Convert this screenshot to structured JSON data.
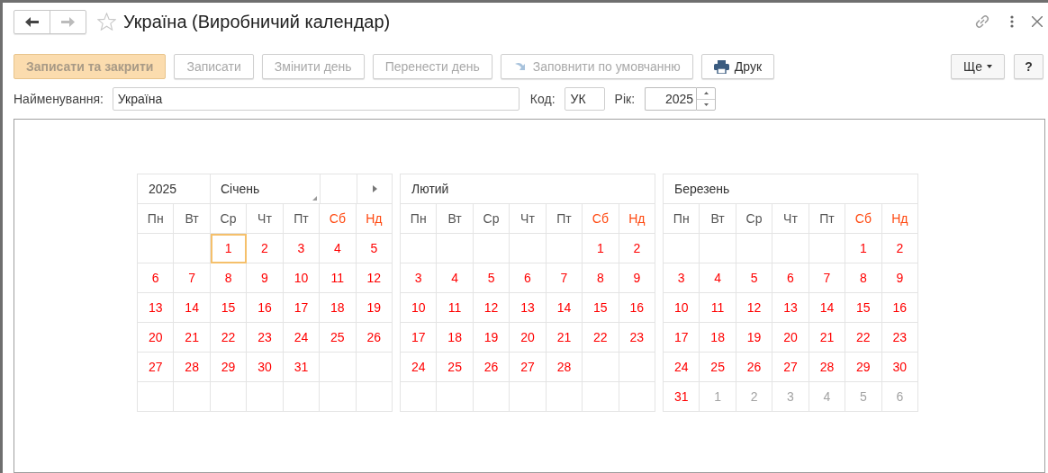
{
  "window": {
    "title": "Україна (Виробничий календар)",
    "favorite": false
  },
  "toolbar": {
    "buttons": [
      {
        "label": "Записати та закрити",
        "kind": "default",
        "disabled": true
      },
      {
        "label": "Записати",
        "kind": "plain",
        "disabled": true
      },
      {
        "label": "Змінити день",
        "kind": "plain",
        "disabled": true
      },
      {
        "label": "Перенести день",
        "kind": "plain",
        "disabled": true
      },
      {
        "label": "Заповнити по умовчанню",
        "kind": "fill",
        "disabled": true
      },
      {
        "label": "Друк",
        "kind": "print",
        "disabled": false
      }
    ],
    "more": {
      "label": "Ще"
    },
    "help": {
      "label": "?"
    }
  },
  "fields": {
    "name": {
      "label": "Найменування:",
      "value": "Україна"
    },
    "code": {
      "label": "Код:",
      "value": "УК"
    },
    "year": {
      "label": "Рік:",
      "value": "2025"
    }
  },
  "calendar": {
    "year": "2025",
    "months": [
      {
        "name": "Січень",
        "weekdays": [
          {
            "label": "Пн",
            "weekend": false
          },
          {
            "label": "Вт",
            "weekend": false
          },
          {
            "label": "Ср",
            "weekend": false
          },
          {
            "label": "Чт",
            "weekend": false
          },
          {
            "label": "Пт",
            "weekend": false
          },
          {
            "label": "Сб",
            "weekend": true
          },
          {
            "label": "Нд",
            "weekend": true
          }
        ],
        "weeks": [
          [
            {
              "kind": "blank",
              "selected": false
            },
            {
              "kind": "blank",
              "selected": false
            },
            {
              "kind": "day",
              "d": "1",
              "selected": true
            },
            {
              "kind": "day",
              "d": "2",
              "selected": false
            },
            {
              "kind": "day",
              "d": "3",
              "selected": false
            },
            {
              "kind": "day",
              "d": "4",
              "selected": false
            },
            {
              "kind": "day",
              "d": "5",
              "selected": false
            }
          ],
          [
            {
              "kind": "day",
              "d": "6",
              "selected": false
            },
            {
              "kind": "day",
              "d": "7",
              "selected": false
            },
            {
              "kind": "day",
              "d": "8",
              "selected": false
            },
            {
              "kind": "day",
              "d": "9",
              "selected": false
            },
            {
              "kind": "day",
              "d": "10",
              "selected": false
            },
            {
              "kind": "day",
              "d": "11",
              "selected": false
            },
            {
              "kind": "day",
              "d": "12",
              "selected": false
            }
          ],
          [
            {
              "kind": "day",
              "d": "13",
              "selected": false
            },
            {
              "kind": "day",
              "d": "14",
              "selected": false
            },
            {
              "kind": "day",
              "d": "15",
              "selected": false
            },
            {
              "kind": "day",
              "d": "16",
              "selected": false
            },
            {
              "kind": "day",
              "d": "17",
              "selected": false
            },
            {
              "kind": "day",
              "d": "18",
              "selected": false
            },
            {
              "kind": "day",
              "d": "19",
              "selected": false
            }
          ],
          [
            {
              "kind": "day",
              "d": "20",
              "selected": false
            },
            {
              "kind": "day",
              "d": "21",
              "selected": false
            },
            {
              "kind": "day",
              "d": "22",
              "selected": false
            },
            {
              "kind": "day",
              "d": "23",
              "selected": false
            },
            {
              "kind": "day",
              "d": "24",
              "selected": false
            },
            {
              "kind": "day",
              "d": "25",
              "selected": false
            },
            {
              "kind": "day",
              "d": "26",
              "selected": false
            }
          ],
          [
            {
              "kind": "day",
              "d": "27",
              "selected": false
            },
            {
              "kind": "day",
              "d": "28",
              "selected": false
            },
            {
              "kind": "day",
              "d": "29",
              "selected": false
            },
            {
              "kind": "day",
              "d": "30",
              "selected": false
            },
            {
              "kind": "day",
              "d": "31",
              "selected": false
            },
            {
              "kind": "blank",
              "selected": false
            },
            {
              "kind": "blank",
              "selected": false
            }
          ],
          [
            {
              "kind": "blank",
              "selected": false
            },
            {
              "kind": "blank",
              "selected": false
            },
            {
              "kind": "blank",
              "selected": false
            },
            {
              "kind": "blank",
              "selected": false
            },
            {
              "kind": "blank",
              "selected": false
            },
            {
              "kind": "blank",
              "selected": false
            },
            {
              "kind": "blank",
              "selected": false
            }
          ]
        ]
      },
      {
        "name": "Лютий",
        "weekdays": [
          {
            "label": "Пн",
            "weekend": false
          },
          {
            "label": "Вт",
            "weekend": false
          },
          {
            "label": "Ср",
            "weekend": false
          },
          {
            "label": "Чт",
            "weekend": false
          },
          {
            "label": "Пт",
            "weekend": false
          },
          {
            "label": "Сб",
            "weekend": true
          },
          {
            "label": "Нд",
            "weekend": true
          }
        ],
        "weeks": [
          [
            {
              "kind": "blank",
              "selected": false
            },
            {
              "kind": "blank",
              "selected": false
            },
            {
              "kind": "blank",
              "selected": false
            },
            {
              "kind": "blank",
              "selected": false
            },
            {
              "kind": "blank",
              "selected": false
            },
            {
              "kind": "day",
              "d": "1",
              "selected": false
            },
            {
              "kind": "day",
              "d": "2",
              "selected": false
            }
          ],
          [
            {
              "kind": "day",
              "d": "3",
              "selected": false
            },
            {
              "kind": "day",
              "d": "4",
              "selected": false
            },
            {
              "kind": "day",
              "d": "5",
              "selected": false
            },
            {
              "kind": "day",
              "d": "6",
              "selected": false
            },
            {
              "kind": "day",
              "d": "7",
              "selected": false
            },
            {
              "kind": "day",
              "d": "8",
              "selected": false
            },
            {
              "kind": "day",
              "d": "9",
              "selected": false
            }
          ],
          [
            {
              "kind": "day",
              "d": "10",
              "selected": false
            },
            {
              "kind": "day",
              "d": "11",
              "selected": false
            },
            {
              "kind": "day",
              "d": "12",
              "selected": false
            },
            {
              "kind": "day",
              "d": "13",
              "selected": false
            },
            {
              "kind": "day",
              "d": "14",
              "selected": false
            },
            {
              "kind": "day",
              "d": "15",
              "selected": false
            },
            {
              "kind": "day",
              "d": "16",
              "selected": false
            }
          ],
          [
            {
              "kind": "day",
              "d": "17",
              "selected": false
            },
            {
              "kind": "day",
              "d": "18",
              "selected": false
            },
            {
              "kind": "day",
              "d": "19",
              "selected": false
            },
            {
              "kind": "day",
              "d": "20",
              "selected": false
            },
            {
              "kind": "day",
              "d": "21",
              "selected": false
            },
            {
              "kind": "day",
              "d": "22",
              "selected": false
            },
            {
              "kind": "day",
              "d": "23",
              "selected": false
            }
          ],
          [
            {
              "kind": "day",
              "d": "24",
              "selected": false
            },
            {
              "kind": "day",
              "d": "25",
              "selected": false
            },
            {
              "kind": "day",
              "d": "26",
              "selected": false
            },
            {
              "kind": "day",
              "d": "27",
              "selected": false
            },
            {
              "kind": "day",
              "d": "28",
              "selected": false
            },
            {
              "kind": "blank",
              "selected": false
            },
            {
              "kind": "blank",
              "selected": false
            }
          ],
          [
            {
              "kind": "blank",
              "selected": false
            },
            {
              "kind": "blank",
              "selected": false
            },
            {
              "kind": "blank",
              "selected": false
            },
            {
              "kind": "blank",
              "selected": false
            },
            {
              "kind": "blank",
              "selected": false
            },
            {
              "kind": "blank",
              "selected": false
            },
            {
              "kind": "blank",
              "selected": false
            }
          ]
        ]
      },
      {
        "name": "Березень",
        "weekdays": [
          {
            "label": "Пн",
            "weekend": false
          },
          {
            "label": "Вт",
            "weekend": false
          },
          {
            "label": "Ср",
            "weekend": false
          },
          {
            "label": "Чт",
            "weekend": false
          },
          {
            "label": "Пт",
            "weekend": false
          },
          {
            "label": "Сб",
            "weekend": true
          },
          {
            "label": "Нд",
            "weekend": true
          }
        ],
        "weeks": [
          [
            {
              "kind": "blank",
              "selected": false
            },
            {
              "kind": "blank",
              "selected": false
            },
            {
              "kind": "blank",
              "selected": false
            },
            {
              "kind": "blank",
              "selected": false
            },
            {
              "kind": "blank",
              "selected": false
            },
            {
              "kind": "day",
              "d": "1",
              "selected": false
            },
            {
              "kind": "day",
              "d": "2",
              "selected": false
            }
          ],
          [
            {
              "kind": "day",
              "d": "3",
              "selected": false
            },
            {
              "kind": "day",
              "d": "4",
              "selected": false
            },
            {
              "kind": "day",
              "d": "5",
              "selected": false
            },
            {
              "kind": "day",
              "d": "6",
              "selected": false
            },
            {
              "kind": "day",
              "d": "7",
              "selected": false
            },
            {
              "kind": "day",
              "d": "8",
              "selected": false
            },
            {
              "kind": "day",
              "d": "9",
              "selected": false
            }
          ],
          [
            {
              "kind": "day",
              "d": "10",
              "selected": false
            },
            {
              "kind": "day",
              "d": "11",
              "selected": false
            },
            {
              "kind": "day",
              "d": "12",
              "selected": false
            },
            {
              "kind": "day",
              "d": "13",
              "selected": false
            },
            {
              "kind": "day",
              "d": "14",
              "selected": false
            },
            {
              "kind": "day",
              "d": "15",
              "selected": false
            },
            {
              "kind": "day",
              "d": "16",
              "selected": false
            }
          ],
          [
            {
              "kind": "day",
              "d": "17",
              "selected": false
            },
            {
              "kind": "day",
              "d": "18",
              "selected": false
            },
            {
              "kind": "day",
              "d": "19",
              "selected": false
            },
            {
              "kind": "day",
              "d": "20",
              "selected": false
            },
            {
              "kind": "day",
              "d": "21",
              "selected": false
            },
            {
              "kind": "day",
              "d": "22",
              "selected": false
            },
            {
              "kind": "day",
              "d": "23",
              "selected": false
            }
          ],
          [
            {
              "kind": "day",
              "d": "24",
              "selected": false
            },
            {
              "kind": "day",
              "d": "25",
              "selected": false
            },
            {
              "kind": "day",
              "d": "26",
              "selected": false
            },
            {
              "kind": "day",
              "d": "27",
              "selected": false
            },
            {
              "kind": "day",
              "d": "28",
              "selected": false
            },
            {
              "kind": "day",
              "d": "29",
              "selected": false
            },
            {
              "kind": "day",
              "d": "30",
              "selected": false
            }
          ],
          [
            {
              "kind": "day",
              "d": "31",
              "selected": false
            },
            {
              "kind": "other",
              "d": "1",
              "selected": false
            },
            {
              "kind": "other",
              "d": "2",
              "selected": false
            },
            {
              "kind": "other",
              "d": "3",
              "selected": false
            },
            {
              "kind": "other",
              "d": "4",
              "selected": false
            },
            {
              "kind": "other",
              "d": "5",
              "selected": false
            },
            {
              "kind": "other",
              "d": "6",
              "selected": false
            }
          ]
        ]
      }
    ]
  }
}
